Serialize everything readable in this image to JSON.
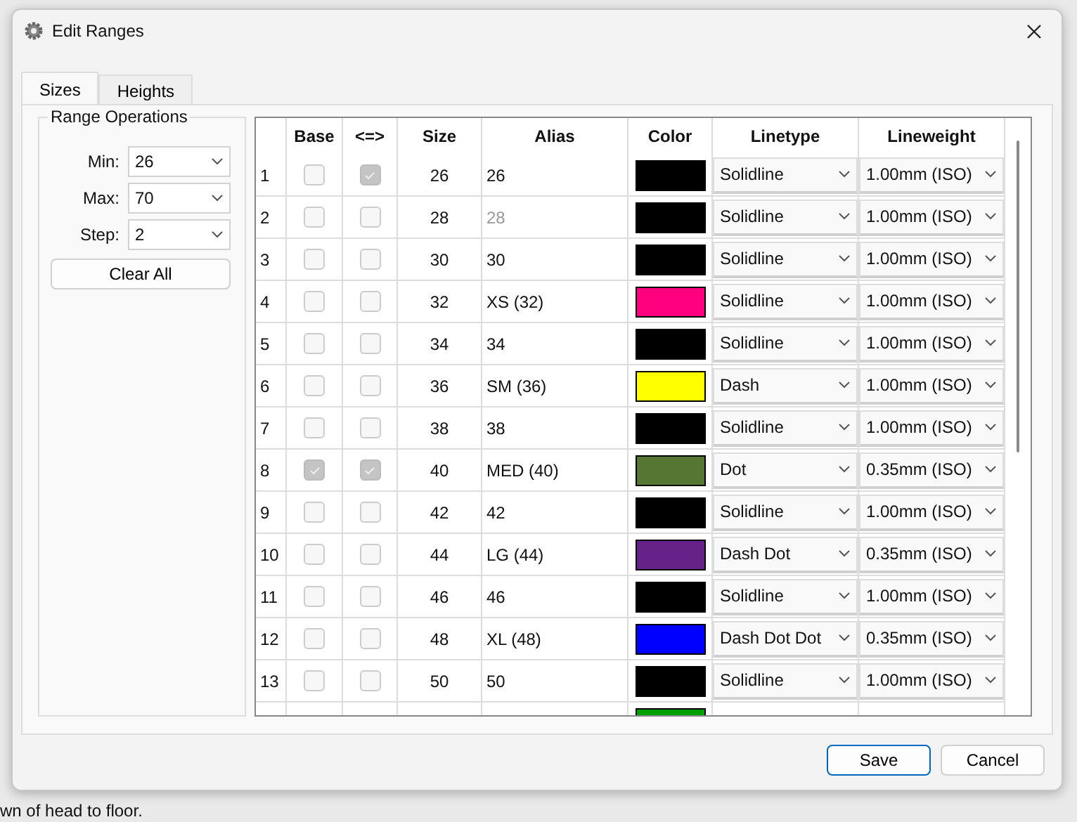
{
  "window": {
    "title": "Edit Ranges"
  },
  "tabs": [
    {
      "label": "Sizes",
      "selected": true
    },
    {
      "label": "Heights",
      "selected": false
    }
  ],
  "range_operations": {
    "title": "Range Operations",
    "fields": [
      {
        "label": "Min:",
        "value": "26"
      },
      {
        "label": "Max:",
        "value": "70"
      },
      {
        "label": "Step:",
        "value": "2"
      }
    ],
    "clear_button": "Clear All"
  },
  "table": {
    "columns": [
      "Base",
      "<=>",
      "Size",
      "Alias",
      "Color",
      "Linetype",
      "Lineweight"
    ],
    "rows": [
      {
        "number": "1",
        "base": false,
        "sync": true,
        "size": "26",
        "alias": "26",
        "alias_dimmed": false,
        "color": "#000000",
        "linetype": "Solidline",
        "lineweight": "1.00mm (ISO)"
      },
      {
        "number": "2",
        "base": false,
        "sync": false,
        "size": "28",
        "alias": "28",
        "alias_dimmed": true,
        "color": "#000000",
        "linetype": "Solidline",
        "lineweight": "1.00mm (ISO)"
      },
      {
        "number": "3",
        "base": false,
        "sync": false,
        "size": "30",
        "alias": "30",
        "alias_dimmed": false,
        "color": "#000000",
        "linetype": "Solidline",
        "lineweight": "1.00mm (ISO)"
      },
      {
        "number": "4",
        "base": false,
        "sync": false,
        "size": "32",
        "alias": "XS (32)",
        "alias_dimmed": false,
        "color": "#ff0080",
        "linetype": "Solidline",
        "lineweight": "1.00mm (ISO)"
      },
      {
        "number": "5",
        "base": false,
        "sync": false,
        "size": "34",
        "alias": "34",
        "alias_dimmed": false,
        "color": "#000000",
        "linetype": "Solidline",
        "lineweight": "1.00mm (ISO)"
      },
      {
        "number": "6",
        "base": false,
        "sync": false,
        "size": "36",
        "alias": "SM (36)",
        "alias_dimmed": false,
        "color": "#ffff00",
        "linetype": "Dash",
        "lineweight": "1.00mm (ISO)"
      },
      {
        "number": "7",
        "base": false,
        "sync": false,
        "size": "38",
        "alias": "38",
        "alias_dimmed": false,
        "color": "#000000",
        "linetype": "Solidline",
        "lineweight": "1.00mm (ISO)"
      },
      {
        "number": "8",
        "base": true,
        "sync": true,
        "size": "40",
        "alias": "MED (40)",
        "alias_dimmed": false,
        "color": "#557733",
        "linetype": "Dot",
        "lineweight": "0.35mm (ISO)"
      },
      {
        "number": "9",
        "base": false,
        "sync": false,
        "size": "42",
        "alias": "42",
        "alias_dimmed": false,
        "color": "#000000",
        "linetype": "Solidline",
        "lineweight": "1.00mm (ISO)"
      },
      {
        "number": "10",
        "base": false,
        "sync": false,
        "size": "44",
        "alias": "LG (44)",
        "alias_dimmed": false,
        "color": "#662288",
        "linetype": "Dash Dot",
        "lineweight": "0.35mm (ISO)"
      },
      {
        "number": "11",
        "base": false,
        "sync": false,
        "size": "46",
        "alias": "46",
        "alias_dimmed": false,
        "color": "#000000",
        "linetype": "Solidline",
        "lineweight": "1.00mm (ISO)"
      },
      {
        "number": "12",
        "base": false,
        "sync": false,
        "size": "48",
        "alias": "XL (48)",
        "alias_dimmed": false,
        "color": "#0000ff",
        "linetype": "Dash Dot Dot",
        "lineweight": "0.35mm (ISO)"
      },
      {
        "number": "13",
        "base": false,
        "sync": false,
        "size": "50",
        "alias": "50",
        "alias_dimmed": false,
        "color": "#000000",
        "linetype": "Solidline",
        "lineweight": "1.00mm (ISO)"
      },
      {
        "color": "#00a000"
      }
    ]
  },
  "buttons": [
    {
      "label": "Save",
      "default": true
    },
    {
      "label": "Cancel",
      "default": false
    }
  ],
  "background_text": "wn of head to floor."
}
